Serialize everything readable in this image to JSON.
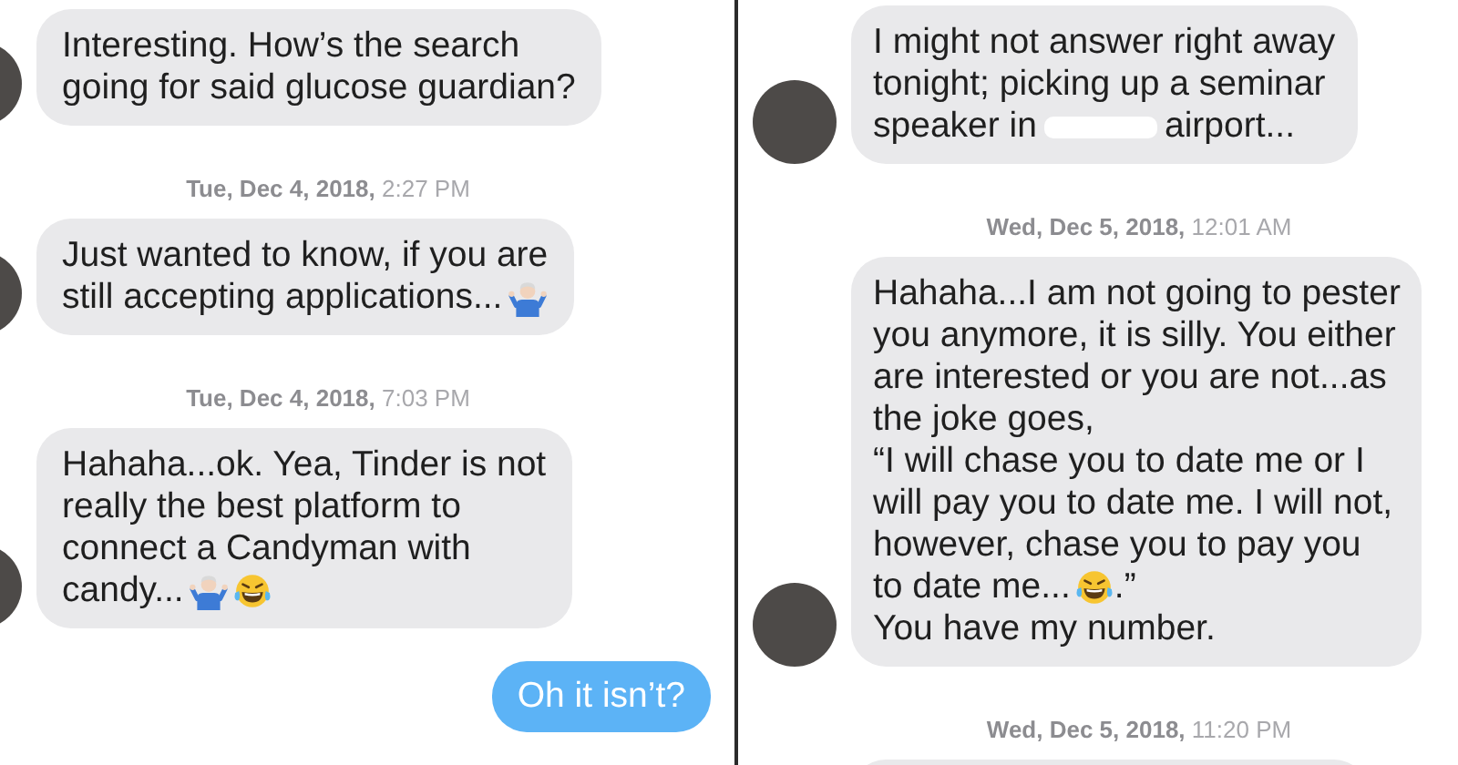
{
  "panels": [
    {
      "items": [
        {
          "kind": "message",
          "outgoing": false,
          "avatar": true,
          "lines": [
            [
              {
                "kind": "text",
                "text": "Interesting. How’s the search"
              }
            ],
            [
              {
                "kind": "text",
                "text": "going for said glucose guardian?"
              }
            ]
          ]
        },
        {
          "kind": "timestamp",
          "text": "**Tue, Dec 4, 2018,** 2:27 PM"
        },
        {
          "kind": "message",
          "outgoing": false,
          "avatar": true,
          "lines": [
            [
              {
                "kind": "text",
                "text": "Just wanted to know, if you are"
              }
            ],
            [
              {
                "kind": "text",
                "text": "still accepting applications..."
              },
              {
                "kind": "shrug"
              }
            ]
          ]
        },
        {
          "kind": "timestamp",
          "text": "**Tue, Dec 4, 2018,** 7:03 PM"
        },
        {
          "kind": "message",
          "outgoing": false,
          "avatar": true,
          "lines": [
            [
              {
                "kind": "text",
                "text": "Hahaha...ok. Yea, Tinder is not"
              }
            ],
            [
              {
                "kind": "text",
                "text": "really the best platform to"
              }
            ],
            [
              {
                "kind": "text",
                "text": "connect a Candyman with"
              }
            ],
            [
              {
                "kind": "text",
                "text": "candy..."
              },
              {
                "kind": "shrug"
              },
              {
                "kind": "laugh"
              }
            ]
          ]
        },
        {
          "kind": "message",
          "outgoing": true,
          "lines": [
            [
              {
                "kind": "text",
                "text": "Oh it isn’t?"
              }
            ]
          ]
        }
      ]
    },
    {
      "items": [
        {
          "kind": "message",
          "outgoing": false,
          "avatar": true,
          "lines": [
            [
              {
                "kind": "text",
                "text": "I might not answer right away"
              }
            ],
            [
              {
                "kind": "text",
                "text": "tonight; picking up a seminar"
              }
            ],
            [
              {
                "kind": "text",
                "text": "speaker in"
              },
              {
                "kind": "redacted"
              },
              {
                "kind": "text",
                "text": "airport..."
              }
            ]
          ]
        },
        {
          "kind": "timestamp",
          "text": "**Wed, Dec 5, 2018,** 12:01 AM"
        },
        {
          "kind": "message",
          "outgoing": false,
          "avatar": true,
          "lines": [
            [
              {
                "kind": "text",
                "text": "Hahaha...I am not going to pester"
              }
            ],
            [
              {
                "kind": "text",
                "text": "you anymore, it is silly. You either"
              }
            ],
            [
              {
                "kind": "text",
                "text": "are interested or you are not...as"
              }
            ],
            [
              {
                "kind": "text",
                "text": "the joke goes,"
              }
            ],
            [
              {
                "kind": "text",
                "text": "“I will chase you to date me or I"
              }
            ],
            [
              {
                "kind": "text",
                "text": "will pay you to date me. I will not,"
              }
            ],
            [
              {
                "kind": "text",
                "text": "however, chase you to pay you"
              }
            ],
            [
              {
                "kind": "text",
                "text": "to date me..."
              },
              {
                "kind": "laugh"
              },
              {
                "kind": "text",
                "text": ".”"
              }
            ],
            [
              {
                "kind": "text",
                "text": "You have my number."
              }
            ]
          ]
        },
        {
          "kind": "timestamp",
          "text": "**Wed, Dec 5, 2018,** 11:20 PM"
        },
        {
          "kind": "message",
          "outgoing": false
        }
      ]
    }
  ]
}
